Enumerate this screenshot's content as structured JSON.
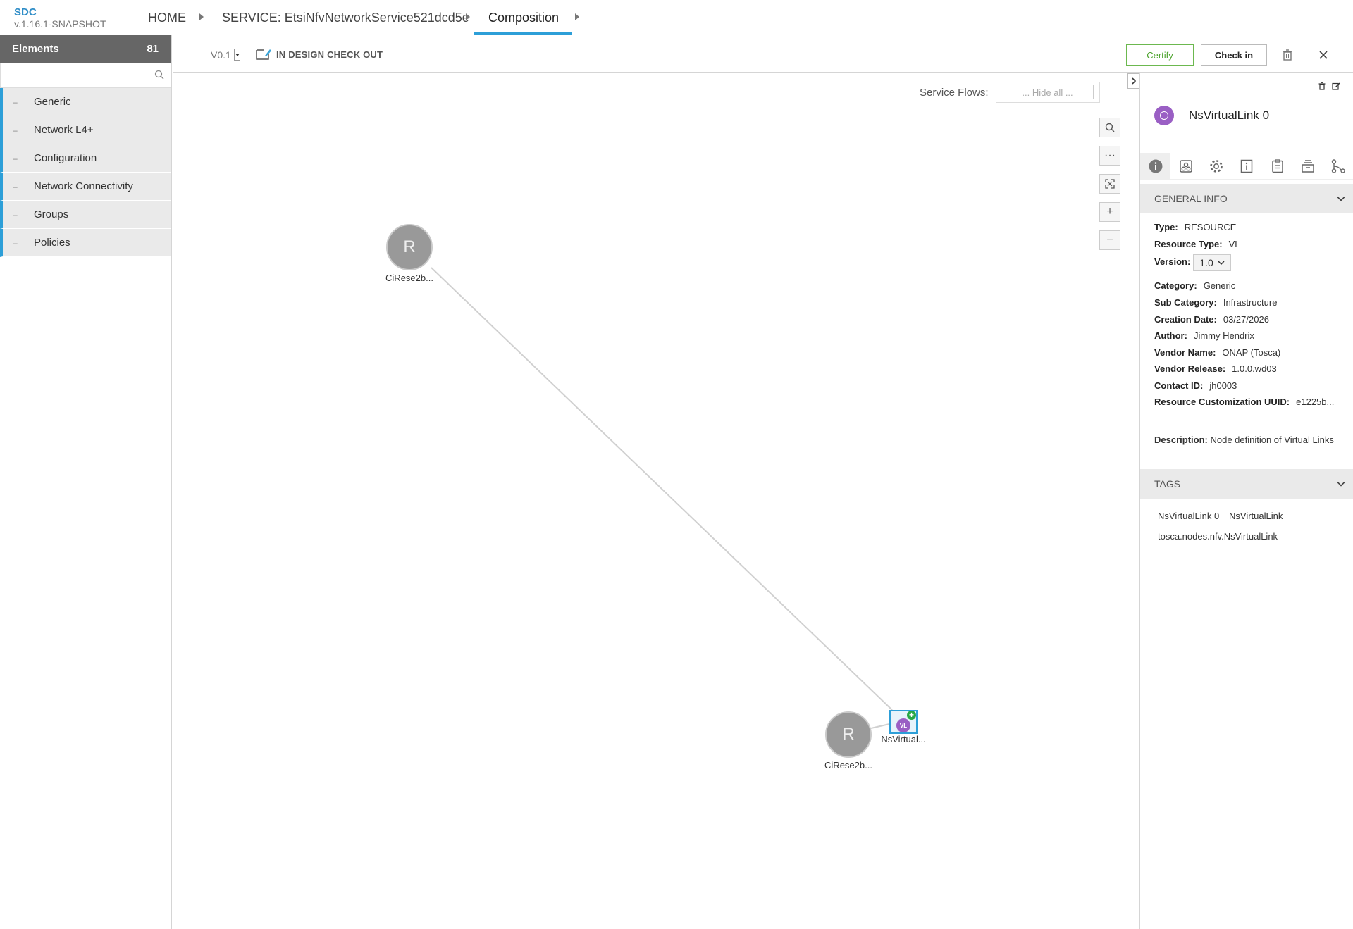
{
  "header": {
    "app_name": "SDC",
    "app_version": "v.1.16.1-SNAPSHOT",
    "breadcrumbs": [
      "HOME",
      "SERVICE: EtsiNfvNetworkService521dcd5e",
      "Composition"
    ]
  },
  "palette": {
    "title": "Elements",
    "count": "81",
    "search_placeholder": "",
    "items": [
      "Generic",
      "Network L4+",
      "Configuration",
      "Network Connectivity",
      "Groups",
      "Policies"
    ],
    "accent_color": "#2d9fd8"
  },
  "toolbar": {
    "version": "V0.1",
    "status": "IN DESIGN CHECK OUT",
    "certify_label": "Certify",
    "checkin_label": "Check in"
  },
  "canvas": {
    "service_flows_label": "Service Flows:",
    "service_flows_value": "... Hide all ...",
    "nodes": [
      {
        "letter": "R",
        "label": "CiRese2b..."
      },
      {
        "letter": "R",
        "label": "CiRese2b..."
      },
      {
        "badge": "VL",
        "label": "NsVirtual..."
      }
    ]
  },
  "panel": {
    "title": "NsVirtualLink 0",
    "icon_color": "#9a5fc4",
    "tabs": [
      "info-icon",
      "composition-icon",
      "gear-icon",
      "properties-icon",
      "artifacts-icon",
      "inputs-icon",
      "relations-icon"
    ],
    "general_info": {
      "heading": "GENERAL INFO",
      "rows": [
        {
          "label": "Type:",
          "value": "RESOURCE"
        },
        {
          "label": "Resource Type:",
          "value": "VL"
        },
        {
          "label": "Version:",
          "value": "1.0"
        },
        {
          "label": "Category:",
          "value": "Generic"
        },
        {
          "label": "Sub Category:",
          "value": "Infrastructure"
        },
        {
          "label": "Creation Date:",
          "value": "03/27/2026"
        },
        {
          "label": "Author:",
          "value": "Jimmy Hendrix"
        },
        {
          "label": "Vendor Name:",
          "value": "ONAP (Tosca)"
        },
        {
          "label": "Vendor Release:",
          "value": "1.0.0.wd03"
        },
        {
          "label": "Contact ID:",
          "value": "jh0003"
        },
        {
          "label": "Resource Customization UUID:",
          "value": "e1225b..."
        }
      ],
      "description_label": "Description:",
      "description": "Node definition of Virtual Links"
    },
    "tags": {
      "heading": "TAGS",
      "items": [
        "NsVirtualLink 0",
        "NsVirtualLink",
        "tosca.nodes.nfv.NsVirtualLink"
      ]
    }
  }
}
